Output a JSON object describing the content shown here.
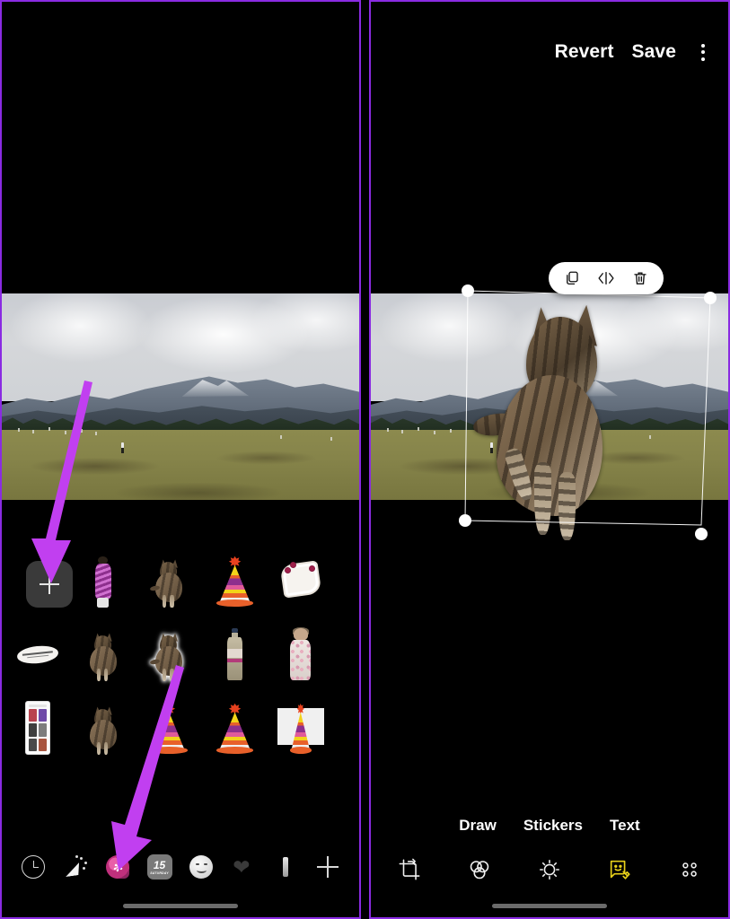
{
  "meta": {
    "accent_purple": "#c13ff0",
    "border_purple": "#8a2be2",
    "background": "#000000",
    "highlight_yellow": "#e8d11a"
  },
  "left_panel": {
    "name": "Sticker picker screen",
    "photo": {
      "alt": "Mountain meadow landscape with cloudy sky and pine forest",
      "subjects": [
        "cloudy-sky",
        "snow-capped-mountain",
        "pine-forest",
        "grass-meadow",
        "walking-person"
      ]
    },
    "sticker_tray": {
      "add_button_label": "+",
      "add_button_name": "add-sticker-button",
      "stickers": [
        {
          "id": "add",
          "kind": "add-button",
          "label": "+"
        },
        {
          "id": "s1",
          "kind": "person",
          "label": "Person in purple robe sticker",
          "selected": false
        },
        {
          "id": "s2",
          "kind": "cat",
          "label": "Cat walking sticker",
          "selected": false
        },
        {
          "id": "s3",
          "kind": "hat",
          "label": "Party hat sticker",
          "selected": false
        },
        {
          "id": "s4",
          "kind": "plate",
          "label": "Floral plate sticker",
          "selected": false
        },
        {
          "id": "s5",
          "kind": "text",
          "label": "Handwritten note sticker",
          "selected": false
        },
        {
          "id": "s6",
          "kind": "cat",
          "label": "Cat sitting sticker",
          "selected": false
        },
        {
          "id": "s7",
          "kind": "cat",
          "label": "Cat sticker (recently used)",
          "selected": true
        },
        {
          "id": "s8",
          "kind": "bottle",
          "label": "Bottle sticker",
          "selected": false
        },
        {
          "id": "s9",
          "kind": "doll",
          "label": "Child figure sticker",
          "selected": false
        },
        {
          "id": "s10",
          "kind": "screenshot",
          "label": "Phone screenshot sticker",
          "selected": false
        },
        {
          "id": "s11",
          "kind": "cat",
          "label": "Cat standing sticker",
          "selected": false
        },
        {
          "id": "s12",
          "kind": "hat",
          "label": "Party hat sticker",
          "selected": false
        },
        {
          "id": "s13",
          "kind": "hat",
          "label": "Party hat sticker",
          "selected": false
        },
        {
          "id": "s14",
          "kind": "hat-card",
          "label": "Party hat on white card sticker",
          "selected": false
        }
      ]
    },
    "tab_bar": {
      "items": [
        {
          "id": "recents",
          "icon": "clock-icon",
          "label": "Recents",
          "selected": false
        },
        {
          "id": "emoji",
          "icon": "party-popper-icon",
          "label": "Emoji",
          "selected": false
        },
        {
          "id": "stickers",
          "icon": "sticker-icon",
          "label": "Stickers",
          "selected": true
        },
        {
          "id": "memoji",
          "icon": "calendar-icon",
          "label": "Memoji",
          "selected": false,
          "day_number": "15",
          "day_name": "SATURDAY"
        },
        {
          "id": "smileys",
          "icon": "smiley-icon",
          "label": "Smileys",
          "selected": false
        },
        {
          "id": "hearts",
          "icon": "heart-icon",
          "label": "Hearts",
          "selected": false
        },
        {
          "id": "more",
          "icon": "sliver-icon",
          "label": "More",
          "selected": false
        },
        {
          "id": "add",
          "icon": "plus-icon",
          "label": "Add",
          "selected": false
        }
      ]
    }
  },
  "right_panel": {
    "name": "Photo editor with sticker placed",
    "top_bar": {
      "revert_label": "Revert",
      "save_label": "Save",
      "menu_icon": "kebab-menu-icon"
    },
    "photo": {
      "alt": "Mountain meadow landscape with cat sticker overlay",
      "sticker_overlay": "Cat sticker"
    },
    "selection": {
      "handles": 4,
      "handle_color": "#ffffff",
      "float_toolbar": [
        {
          "id": "duplicate",
          "icon": "duplicate-icon",
          "label": "Duplicate"
        },
        {
          "id": "flip",
          "icon": "flip-icon",
          "label": "Flip"
        },
        {
          "id": "delete",
          "icon": "trash-icon",
          "label": "Delete"
        }
      ]
    },
    "mode_row": [
      {
        "id": "draw",
        "label": "Draw",
        "selected": false
      },
      {
        "id": "stickers",
        "label": "Stickers",
        "selected": false
      },
      {
        "id": "text",
        "label": "Text",
        "selected": false
      }
    ],
    "tool_row": [
      {
        "id": "crop",
        "icon": "crop-rotate-icon",
        "label": "Crop",
        "selected": false
      },
      {
        "id": "filters",
        "icon": "filters-icon",
        "label": "Filters",
        "selected": false
      },
      {
        "id": "adjust",
        "icon": "brightness-icon",
        "label": "Adjust",
        "selected": false
      },
      {
        "id": "markup",
        "icon": "markup-icon",
        "label": "Markup",
        "selected": true
      },
      {
        "id": "more",
        "icon": "four-dots-icon",
        "label": "More",
        "selected": false
      }
    ]
  },
  "annotations": [
    {
      "id": "arrow-1",
      "type": "arrow",
      "points_to": "add-sticker-button",
      "color": "#c13ff0"
    },
    {
      "id": "arrow-2",
      "type": "arrow",
      "points_to": "sticker-tab",
      "color": "#c13ff0"
    }
  ]
}
